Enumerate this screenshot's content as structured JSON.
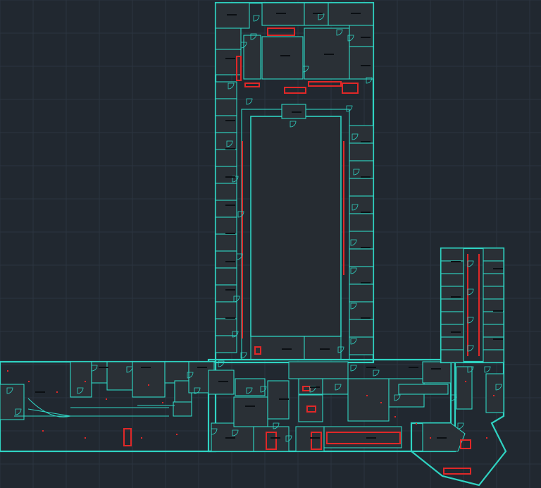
{
  "colors": {
    "background": "#212830",
    "grid": "#2c3540",
    "walls": "#2fd3c2",
    "highlight": "#e02828"
  }
}
